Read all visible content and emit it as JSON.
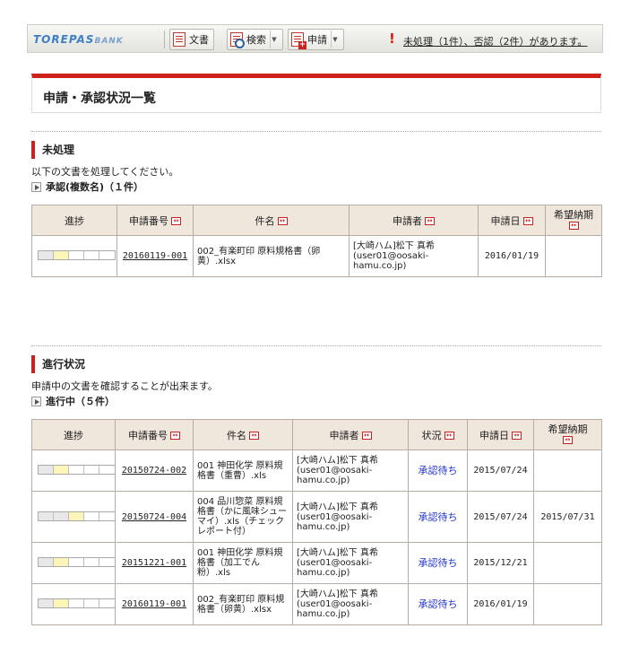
{
  "toolbar": {
    "logo_main": "TOREPAS",
    "logo_sub": "BANK",
    "btn_document": "文書",
    "btn_search": "検索",
    "btn_apply": "申請",
    "warning_text": "未処理（1件）、否認（2件）があります。"
  },
  "page": {
    "title": "申請・承認状況一覧"
  },
  "pending": {
    "heading": "未処理",
    "description": "以下の文書を処理してください。",
    "subheading": "承認(複数名)（１件）",
    "columns": [
      "進捗",
      "申請番号",
      "件名",
      "申請者",
      "申請日",
      "希望納期"
    ],
    "rows": [
      {
        "progress": {
          "segments": 5,
          "done": 1,
          "current": 1
        },
        "app_no": "20160119-001",
        "subject": "002_有楽町印 原料規格書（卵黄）.xlsx",
        "applicant": "[大崎ハム]松下 真希(user01@oosaki-hamu.co.jp)",
        "date": "2016/01/19",
        "due": ""
      }
    ]
  },
  "inprogress": {
    "heading": "進行状況",
    "description": "申請中の文書を確認することが出来ます。",
    "subheading": "進行中（５件）",
    "columns": [
      "進捗",
      "申請番号",
      "件名",
      "申請者",
      "状況",
      "申請日",
      "希望納期"
    ],
    "rows": [
      {
        "progress": {
          "segments": 5,
          "done": 1,
          "current": 1
        },
        "app_no": "20150724-002",
        "subject": "001 神田化学 原料規格書（重曹）.xls",
        "applicant": "[大崎ハム]松下 真希(user01@oosaki-hamu.co.jp)",
        "status": "承認待ち",
        "date": "2015/07/24",
        "due": ""
      },
      {
        "progress": {
          "segments": 5,
          "done": 2,
          "current": 1
        },
        "app_no": "20150724-004",
        "subject": "004 品川惣菜 原料規格書（かに風味シューマイ）.xls（チェックレポート付）",
        "applicant": "[大崎ハム]松下 真希(user01@oosaki-hamu.co.jp)",
        "status": "承認待ち",
        "date": "2015/07/24",
        "due": "2015/07/31"
      },
      {
        "progress": {
          "segments": 5,
          "done": 1,
          "current": 1
        },
        "app_no": "20151221-001",
        "subject": "001 神田化学 原料規格書（加工でん粉）.xls",
        "applicant": "[大崎ハム]松下 真希(user01@oosaki-hamu.co.jp)",
        "status": "承認待ち",
        "date": "2015/12/21",
        "due": ""
      },
      {
        "progress": {
          "segments": 5,
          "done": 1,
          "current": 1
        },
        "app_no": "20160119-001",
        "subject": "002_有楽町印 原料規格書（卵黄）.xlsx",
        "applicant": "[大崎ハム]松下 真希(user01@oosaki-hamu.co.jp)",
        "status": "承認待ち",
        "date": "2016/01/19",
        "due": ""
      }
    ]
  }
}
